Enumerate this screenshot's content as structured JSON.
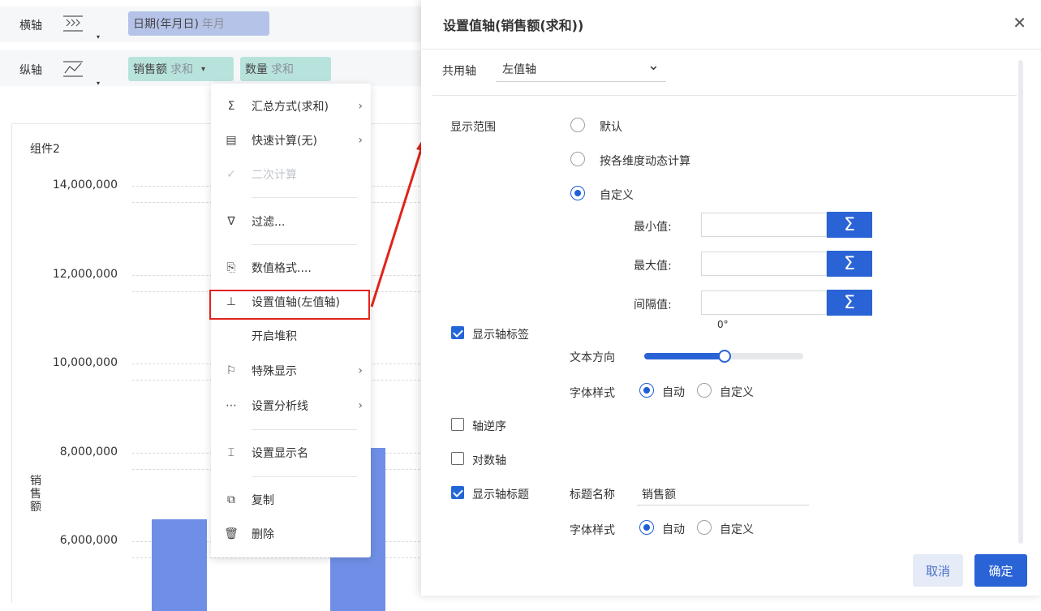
{
  "axes": {
    "x_axis_label": "横轴",
    "y_axis_label": "纵轴",
    "x_field": {
      "name": "日期(年月日)",
      "sub": "年月"
    },
    "y_fields": [
      {
        "name": "销售额",
        "sub": "求和",
        "caret": "▾"
      },
      {
        "name": "数量",
        "sub": "求和"
      }
    ],
    "caret": "▾"
  },
  "chart": {
    "component_title": "组件2",
    "ylabel": "销售额"
  },
  "chart_data": {
    "type": "bar",
    "title": "组件2",
    "ylabel": "销售额",
    "yticks": [
      "14,000,000",
      "12,000,000",
      "10,000,000",
      "8,000,000",
      "6,000,000"
    ],
    "tick_values": [
      14000000,
      12000000,
      10000000,
      8000000,
      6000000
    ],
    "visible_bar_tops": [
      6500000,
      8100000
    ],
    "bar_color": "#6f8fe6"
  },
  "context_menu": {
    "items": [
      {
        "label": "汇总方式(求和)",
        "icon": "sum-icon",
        "glyph": "Σ",
        "arrow": "›"
      },
      {
        "label": "快速计算(无)",
        "icon": "calculator-icon",
        "glyph": "▤",
        "arrow": "›"
      },
      {
        "label": "二次计算",
        "icon": "check-icon",
        "glyph": "✓",
        "disabled": true
      },
      {
        "label": "过滤...",
        "icon": "filter-icon",
        "glyph": "∇"
      },
      {
        "label": "数值格式....",
        "icon": "number-format-icon",
        "glyph": "⎘"
      },
      {
        "label": "设置值轴(左值轴)",
        "icon": "value-axis-icon",
        "glyph": "⊥"
      },
      {
        "label": "开启堆积",
        "icon": "",
        "glyph": ""
      },
      {
        "label": "特殊显示",
        "icon": "flag-icon",
        "glyph": "⚐",
        "arrow": "›"
      },
      {
        "label": "设置分析线",
        "icon": "analysis-line-icon",
        "glyph": "⋯",
        "arrow": "›"
      },
      {
        "label": "设置显示名",
        "icon": "display-name-icon",
        "glyph": "⌶"
      },
      {
        "label": "复制",
        "icon": "copy-icon",
        "glyph": "⧉"
      },
      {
        "label": "删除",
        "icon": "trash-icon",
        "glyph": "🗑"
      }
    ]
  },
  "dialog": {
    "title": "设置值轴(销售额(求和))",
    "close": "✕",
    "shared_axis": {
      "label": "共用轴",
      "value": "左值轴",
      "caret": "⌄"
    },
    "range": {
      "label": "显示范围",
      "options": [
        "默认",
        "按各维度动态计算",
        "自定义"
      ],
      "selected": 2,
      "min_label": "最小值:",
      "max_label": "最大值:",
      "interval_label": "间隔值:",
      "sigma": "Σ"
    },
    "show_axis_labels": {
      "label": "显示轴标签",
      "checked": true
    },
    "text_direction": {
      "label": "文本方向",
      "value": "0°",
      "fraction": 0.5
    },
    "font_style_1": {
      "label": "字体样式",
      "options": [
        "自动",
        "自定义"
      ],
      "selected": 0
    },
    "reverse_axis": {
      "label": "轴逆序",
      "checked": false
    },
    "log_axis": {
      "label": "对数轴",
      "checked": false
    },
    "show_axis_title": {
      "label": "显示轴标题",
      "checked": true
    },
    "title_name": {
      "label": "标题名称",
      "value": "销售额"
    },
    "font_style_2": {
      "label": "字体样式",
      "options": [
        "自动",
        "自定义"
      ],
      "selected": 0
    },
    "cancel_label": "取消",
    "ok_label": "确定"
  },
  "colors": {
    "accent": "#2a63d5",
    "highlight": "#e0241a",
    "bar": "#6f8fe6"
  }
}
